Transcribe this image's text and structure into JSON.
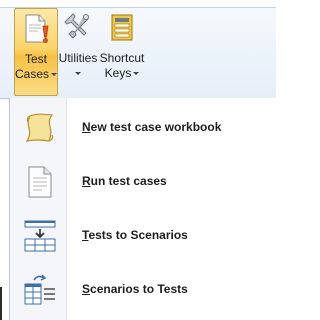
{
  "ribbon": {
    "buttons": [
      {
        "label_line1": "Test",
        "label_line2": "Cases",
        "icon": "document-warning-icon",
        "active": true
      },
      {
        "label_line1": "Utilities",
        "label_line2": "",
        "icon": "tools-icon",
        "active": false
      },
      {
        "label_line1": "Shortcut",
        "label_line2": "Keys",
        "icon": "shortcut-keys-icon",
        "active": false
      }
    ]
  },
  "menu": {
    "items": [
      {
        "label": "New test case workbook",
        "icon": "scroll-icon"
      },
      {
        "label": "Run test cases",
        "icon": "document-icon"
      },
      {
        "label": "Tests to Scenarios",
        "icon": "tests-to-scenarios-icon"
      },
      {
        "label": "Scenarios to Tests",
        "icon": "scenarios-to-tests-icon"
      }
    ]
  },
  "colors": {
    "active_button": "#fbd56b",
    "warning": "#e8541c",
    "ribbon_bg": "#e6eef8"
  }
}
